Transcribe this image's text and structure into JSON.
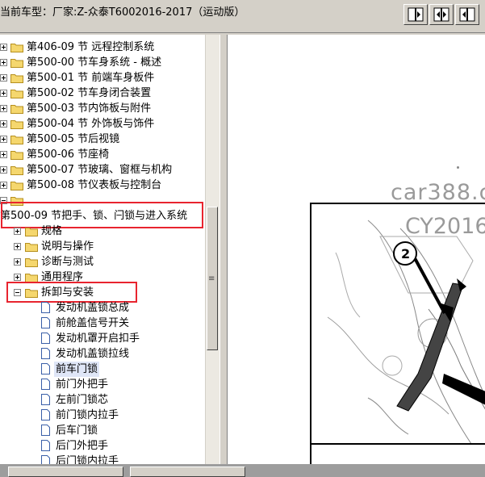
{
  "window": {
    "title": "当前车型：厂家:Z-众泰T6002016-2017（运动版）"
  },
  "toolbar": {
    "buttons": [
      {
        "icon": "split-left-icon"
      },
      {
        "icon": "split-center-icon"
      },
      {
        "icon": "split-right-icon"
      }
    ]
  },
  "tree": {
    "top_items": [
      {
        "label": "第406-09 节 远程控制系统"
      },
      {
        "label": "第500-00 节车身系统 - 概述"
      },
      {
        "label": "第500-01 节 前端车身板件"
      },
      {
        "label": "第500-02 节车身闭合装置"
      },
      {
        "label": "第500-03 节内饰板与附件"
      },
      {
        "label": "第500-04 节 外饰板与饰件"
      },
      {
        "label": "第500-05 节后视镜"
      },
      {
        "label": "第500-06 节座椅"
      },
      {
        "label": "第500-07 节玻璃、窗框与机构"
      },
      {
        "label": "第500-08 节仪表板与控制台"
      }
    ],
    "hidden_item_label": "",
    "expanded_section": {
      "label": "第500-09 节把手、锁、闩锁与进入系统"
    },
    "sub_items": [
      {
        "label": "规格"
      },
      {
        "label": "说明与操作"
      },
      {
        "label": "诊断与测试"
      },
      {
        "label": "通用程序"
      }
    ],
    "expanded_sub": {
      "label": "拆卸与安装"
    },
    "docs": [
      {
        "label": "发动机盖锁总成"
      },
      {
        "label": "前舱盖信号开关"
      },
      {
        "label": "发动机罩开启扣手"
      },
      {
        "label": "发动机盖锁拉线"
      },
      {
        "label": "前车门锁",
        "selected": true
      },
      {
        "label": "前门外把手"
      },
      {
        "label": "左前门锁芯"
      },
      {
        "label": "前门锁内拉手"
      },
      {
        "label": "后车门锁"
      },
      {
        "label": "后门外把手"
      },
      {
        "label": "后门锁内拉手"
      }
    ]
  },
  "viewer": {
    "watermark_1": "car388.c",
    "watermark_2": "CY2016",
    "callout_number": "2"
  },
  "colors": {
    "highlight_box": "#e8242f",
    "selection": "#dfe6f7",
    "folder": "#f5d76e"
  }
}
